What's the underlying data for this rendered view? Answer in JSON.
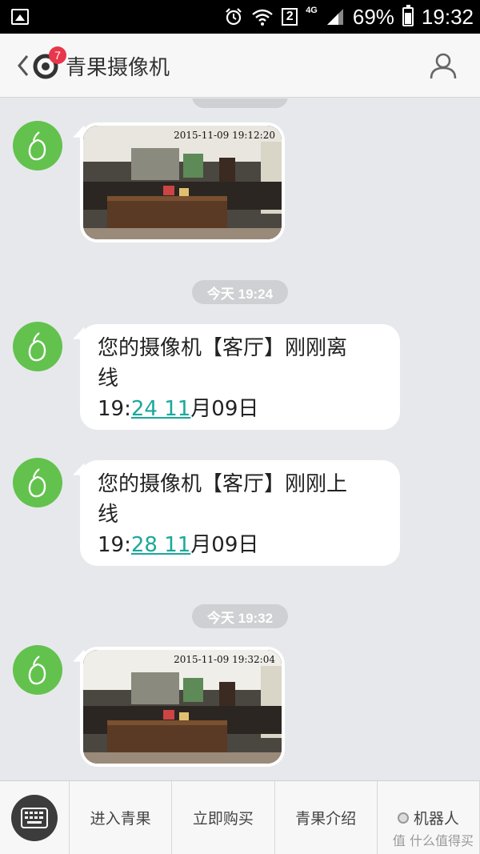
{
  "status_bar": {
    "network": "4G",
    "sim_slot": "2",
    "battery": "69%",
    "battery_level": 0.69,
    "time": "19:32"
  },
  "header": {
    "title": "青果摄像机",
    "unread_count": "7"
  },
  "messages": [
    {
      "type": "image",
      "photo_timestamp": "2015-11-09  19:12:20"
    },
    {
      "type": "timestamp",
      "text": "今天 19:24"
    },
    {
      "type": "text",
      "line1": "您的摄像机【客厅】刚刚离",
      "line2": "线",
      "line3_prefix": "19:",
      "line3_link": "24 11",
      "line3_suffix": "月09日"
    },
    {
      "type": "text",
      "line1": "您的摄像机【客厅】刚刚上",
      "line2": "线",
      "line3_prefix": "19:",
      "line3_link": "28 11",
      "line3_suffix": "月09日"
    },
    {
      "type": "timestamp",
      "text": "今天 19:32"
    },
    {
      "type": "image",
      "photo_timestamp": "2015-11-09  19:32:04"
    }
  ],
  "bottom_menu": {
    "items": [
      "进入青果",
      "立即购买",
      "青果介绍",
      "机器人"
    ]
  },
  "watermark": "值 什么值得买",
  "colors": {
    "avatar_green": "#62c24d",
    "link_teal": "#1aa89a",
    "badge_red": "#e8364b",
    "chat_bg": "#e7e8ec"
  }
}
